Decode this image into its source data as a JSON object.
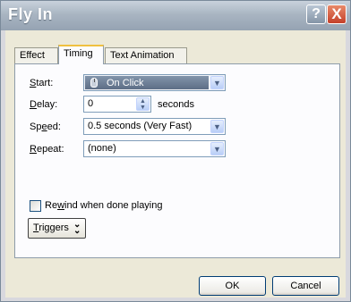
{
  "window": {
    "title": "Fly In",
    "help": "?",
    "close": "X"
  },
  "tabs": [
    {
      "label": "Effect"
    },
    {
      "label": "Timing"
    },
    {
      "label": "Text Animation"
    }
  ],
  "timing": {
    "start": {
      "label_pre": "",
      "label_u": "S",
      "label_post": "tart:",
      "value": "On Click",
      "icon": "mouse-icon"
    },
    "delay": {
      "label_pre": "",
      "label_u": "D",
      "label_post": "elay:",
      "value": "0",
      "unit": "seconds"
    },
    "speed": {
      "label_pre": "Sp",
      "label_u": "e",
      "label_post": "ed:",
      "value": "0.5 seconds (Very Fast)"
    },
    "repeat": {
      "label_pre": "",
      "label_u": "R",
      "label_post": "epeat:",
      "value": "(none)"
    },
    "rewind": {
      "pre": "Re",
      "u": "w",
      "post": "ind when done playing",
      "checked": false
    },
    "triggers": {
      "u": "T",
      "post": "riggers"
    }
  },
  "buttons": {
    "ok": "OK",
    "cancel": "Cancel"
  }
}
